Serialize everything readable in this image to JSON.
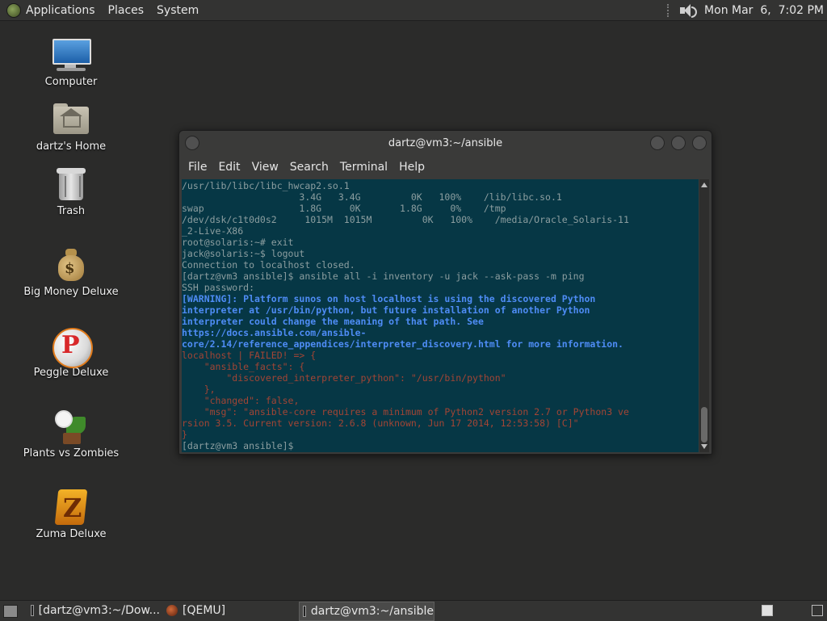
{
  "top_panel": {
    "menus": [
      "Applications",
      "Places",
      "System"
    ],
    "clock": "Mon Mar  6,  7:02 PM",
    "icons": [
      "distro-logo-icon",
      "volume-icon"
    ]
  },
  "desktop": {
    "icons": [
      {
        "label": "Computer",
        "icon": "computer-icon"
      },
      {
        "label": "dartz's Home",
        "icon": "home-folder-icon"
      },
      {
        "label": "Trash",
        "icon": "trash-icon"
      },
      {
        "label": "Big Money Deluxe",
        "icon": "money-bag-icon"
      },
      {
        "label": "Peggle Deluxe",
        "icon": "peggle-icon"
      },
      {
        "label": "Plants vs Zombies",
        "icon": "plants-vs-zombies-icon"
      },
      {
        "label": "Zuma Deluxe",
        "icon": "zuma-icon"
      }
    ]
  },
  "window": {
    "title": "dartz@vm3:~/ansible",
    "menu": [
      "File",
      "Edit",
      "View",
      "Search",
      "Terminal",
      "Help"
    ]
  },
  "terminal": {
    "lines": [
      {
        "t": "/usr/lib/libc/libc_hwcap2.so.1",
        "c": "norm"
      },
      {
        "t": "                     3.4G   3.4G         0K   100%    /lib/libc.so.1",
        "c": "norm"
      },
      {
        "t": "swap                 1.8G     0K       1.8G     0%    /tmp",
        "c": "norm"
      },
      {
        "t": "/dev/dsk/c1t0d0s2     1015M  1015M         0K   100%    /media/Oracle_Solaris-11",
        "c": "norm"
      },
      {
        "t": "_2-Live-X86",
        "c": "norm"
      },
      {
        "t": "root@solaris:~# exit",
        "c": "norm"
      },
      {
        "t": "jack@solaris:~$ logout",
        "c": "norm"
      },
      {
        "t": "Connection to localhost closed.",
        "c": "norm"
      },
      {
        "t": "[dartz@vm3 ansible]$ ansible all -i inventory -u jack --ask-pass -m ping",
        "c": "norm"
      },
      {
        "t": "SSH password:",
        "c": "norm"
      },
      {
        "t": "[WARNING]: Platform sunos on host localhost is using the discovered Python",
        "c": "warn"
      },
      {
        "t": "interpreter at /usr/bin/python, but future installation of another Python",
        "c": "warn"
      },
      {
        "t": "interpreter could change the meaning of that path. See",
        "c": "warn"
      },
      {
        "t": "https://docs.ansible.com/ansible-",
        "c": "warn"
      },
      {
        "t": "core/2.14/reference_appendices/interpreter_discovery.html for more information.",
        "c": "warn"
      },
      {
        "t": "localhost | FAILED! => {",
        "c": "fail"
      },
      {
        "t": "    \"ansible_facts\": {",
        "c": "fail"
      },
      {
        "t": "        \"discovered_interpreter_python\": \"/usr/bin/python\"",
        "c": "fail"
      },
      {
        "t": "    },",
        "c": "fail"
      },
      {
        "t": "    \"changed\": false,",
        "c": "fail"
      },
      {
        "t": "    \"msg\": \"ansible-core requires a minimum of Python2 version 2.7 or Python3 ve",
        "c": "fail"
      },
      {
        "t": "rsion 3.5. Current version: 2.6.8 (unknown, Jun 17 2014, 12:53:58) [C]\"",
        "c": "fail"
      },
      {
        "t": "}",
        "c": "fail"
      },
      {
        "t": "[dartz@vm3 ansible]$ ",
        "c": "norm"
      }
    ],
    "colors": {
      "background": "#063745",
      "norm": "#8c9ea0",
      "warn": "#4e8cf5",
      "fail": "#a24535"
    }
  },
  "bottom_panel": {
    "tasks": [
      {
        "label": "[dartz@vm3:~/Dow...",
        "icon": "terminal-icon",
        "active": false
      },
      {
        "label": "[QEMU]",
        "icon": "qemu-icon",
        "active": false
      },
      {
        "label": "dartz@vm3:~/ansible",
        "icon": "terminal-icon",
        "active": true
      }
    ],
    "workspaces": [
      {
        "active": true
      },
      {
        "active": false
      }
    ]
  }
}
